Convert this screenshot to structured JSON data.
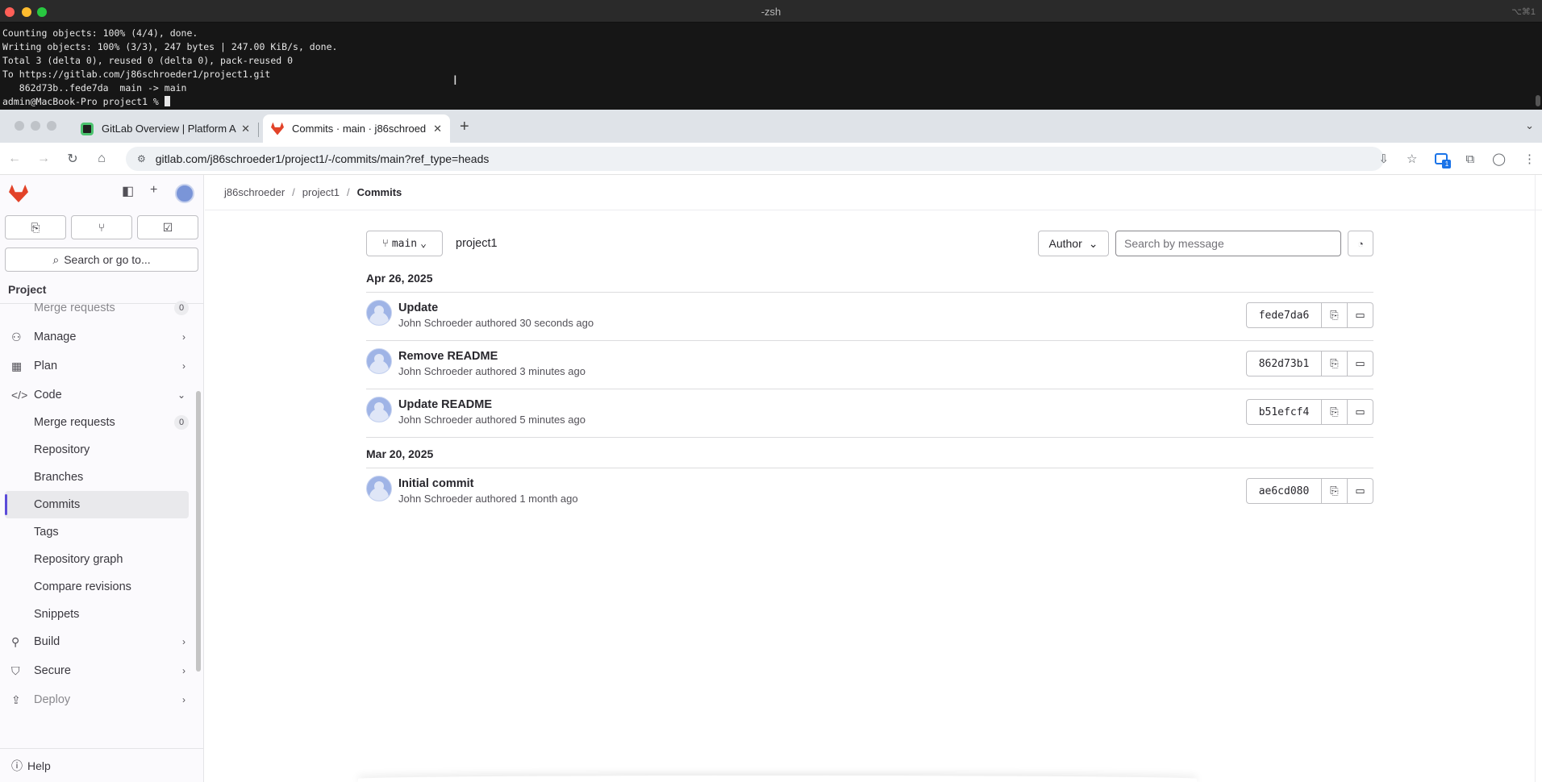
{
  "terminal": {
    "title": "-zsh",
    "shortcut": "⌥⌘1",
    "lines": [
      "Counting objects: 100% (4/4), done.",
      "Writing objects: 100% (3/3), 247 bytes | 247.00 KiB/s, done.",
      "Total 3 (delta 0), reused 0 (delta 0), pack-reused 0",
      "To https://gitlab.com/j86schroeder1/project1.git",
      "   862d73b..fede7da  main -> main"
    ],
    "prompt": "admin@MacBook-Pro project1 % "
  },
  "browser": {
    "tabs": [
      {
        "title": "GitLab Overview | Platform A"
      },
      {
        "title": "Commits · main · j86schroed"
      }
    ],
    "url": "gitlab.com/j86schroeder1/project1/-/commits/main?ref_type=heads",
    "extension_badge": "1"
  },
  "sidebar": {
    "search_label": "Search or go to...",
    "project_heading": "Project",
    "items": [
      {
        "label": "Merge requests",
        "count": "0"
      },
      {
        "label": "Manage"
      },
      {
        "label": "Plan"
      },
      {
        "label": "Code"
      },
      {
        "label": "Merge requests",
        "count": "0"
      },
      {
        "label": "Repository"
      },
      {
        "label": "Branches"
      },
      {
        "label": "Commits"
      },
      {
        "label": "Tags"
      },
      {
        "label": "Repository graph"
      },
      {
        "label": "Compare revisions"
      },
      {
        "label": "Snippets"
      },
      {
        "label": "Build"
      },
      {
        "label": "Secure"
      },
      {
        "label": "Deploy"
      }
    ],
    "help_label": "Help"
  },
  "breadcrumb": {
    "user": "j86schroeder",
    "project": "project1",
    "current": "Commits"
  },
  "filters": {
    "branch": "main",
    "project_name": "project1",
    "author_label": "Author",
    "search_placeholder": "Search by message"
  },
  "commit_groups": [
    {
      "date": "Apr 26, 2025",
      "commits": [
        {
          "message": "Update",
          "meta": "John Schroeder authored 30 seconds ago",
          "sha": "fede7da6"
        },
        {
          "message": "Remove README",
          "meta": "John Schroeder authored 3 minutes ago",
          "sha": "862d73b1"
        },
        {
          "message": "Update README",
          "meta": "John Schroeder authored 5 minutes ago",
          "sha": "b51efcf4"
        }
      ]
    },
    {
      "date": "Mar 20, 2025",
      "commits": [
        {
          "message": "Initial commit",
          "meta": "John Schroeder authored 1 month ago",
          "sha": "ae6cd080"
        }
      ]
    }
  ],
  "colors": {
    "gitlab_orange": "#e24329",
    "active_indicator": "#5b4bd9",
    "terminal_bg": "#161616"
  }
}
